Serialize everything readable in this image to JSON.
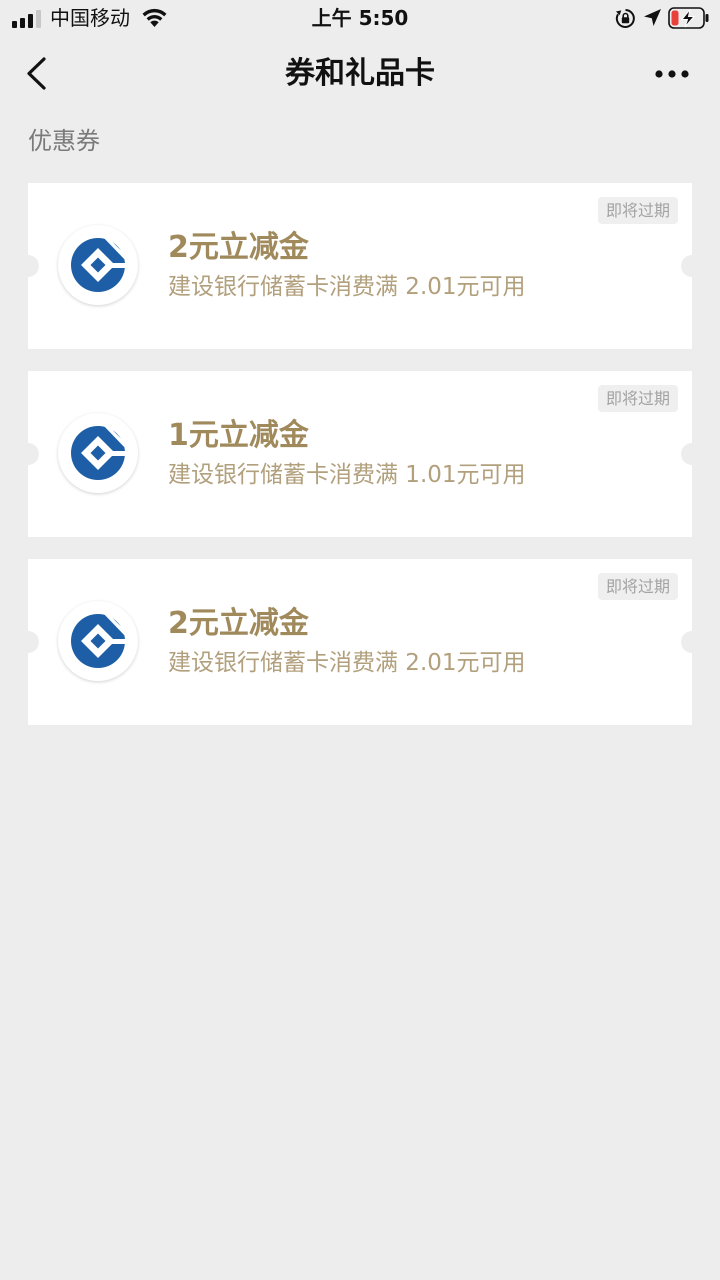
{
  "status_bar": {
    "carrier": "中国移动",
    "time": "上午 5:50",
    "icons": [
      "signal-icon",
      "wifi-icon",
      "rotation-lock-icon",
      "location-icon",
      "battery-charging-icon"
    ]
  },
  "nav": {
    "title": "券和礼品卡",
    "back_icon": "chevron-left-icon",
    "more_icon": "more-dots-icon"
  },
  "section": {
    "title": "优惠券"
  },
  "coupons": [
    {
      "title": "2元立减金",
      "description": "建设银行储蓄卡消费满 2.01元可用",
      "badge": "即将过期",
      "logo_icon": "ccb-bank-logo-icon"
    },
    {
      "title": "1元立减金",
      "description": "建设银行储蓄卡消费满 1.01元可用",
      "badge": "即将过期",
      "logo_icon": "ccb-bank-logo-icon"
    },
    {
      "title": "2元立减金",
      "description": "建设银行储蓄卡消费满 2.01元可用",
      "badge": "即将过期",
      "logo_icon": "ccb-bank-logo-icon"
    }
  ],
  "colors": {
    "background": "#ededed",
    "card": "#ffffff",
    "coupon_title": "#a08a5c",
    "coupon_desc": "#b2a07d",
    "badge_text": "#a3a3a3",
    "bank_blue": "#1d5ea7",
    "battery_low": "#e8403a"
  }
}
